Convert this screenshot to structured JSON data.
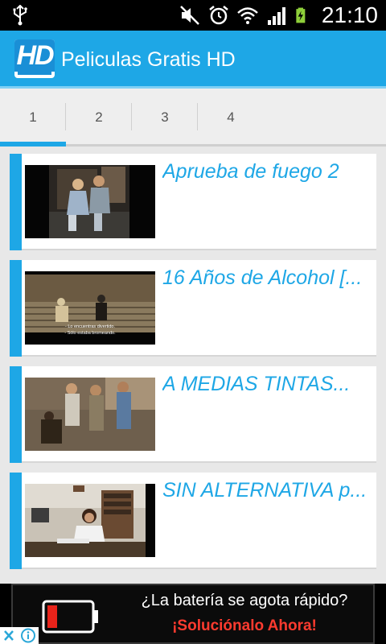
{
  "status_bar": {
    "time": "21:10",
    "icons": [
      "usb-icon",
      "mute-icon",
      "alarm-icon",
      "wifi-icon",
      "signal-icon",
      "battery-charging-icon"
    ]
  },
  "app_bar": {
    "logo_text": "HD",
    "title": "Peliculas Gratis HD"
  },
  "tabs": [
    {
      "label": "1",
      "active": true
    },
    {
      "label": "2",
      "active": false
    },
    {
      "label": "3",
      "active": false
    },
    {
      "label": "4",
      "active": false
    }
  ],
  "movies": [
    {
      "title": "Aprueba de fuego 2"
    },
    {
      "title": "16 Años de Alcohol [..."
    },
    {
      "title": "A MEDIAS TINTAS..."
    },
    {
      "title": "SIN ALTERNATIVA p..."
    }
  ],
  "thumbnail_2_subtitle": {
    "line1": "- Lo encuentras divertido.",
    "line2": "- Sólo estaba bromeando."
  },
  "ad": {
    "line1": "¿La batería se agota rápido?",
    "line2": "¡Soluciónalo Ahora!"
  },
  "colors": {
    "accent": "#1ea7e6",
    "ad_highlight": "#ff3b2f"
  }
}
